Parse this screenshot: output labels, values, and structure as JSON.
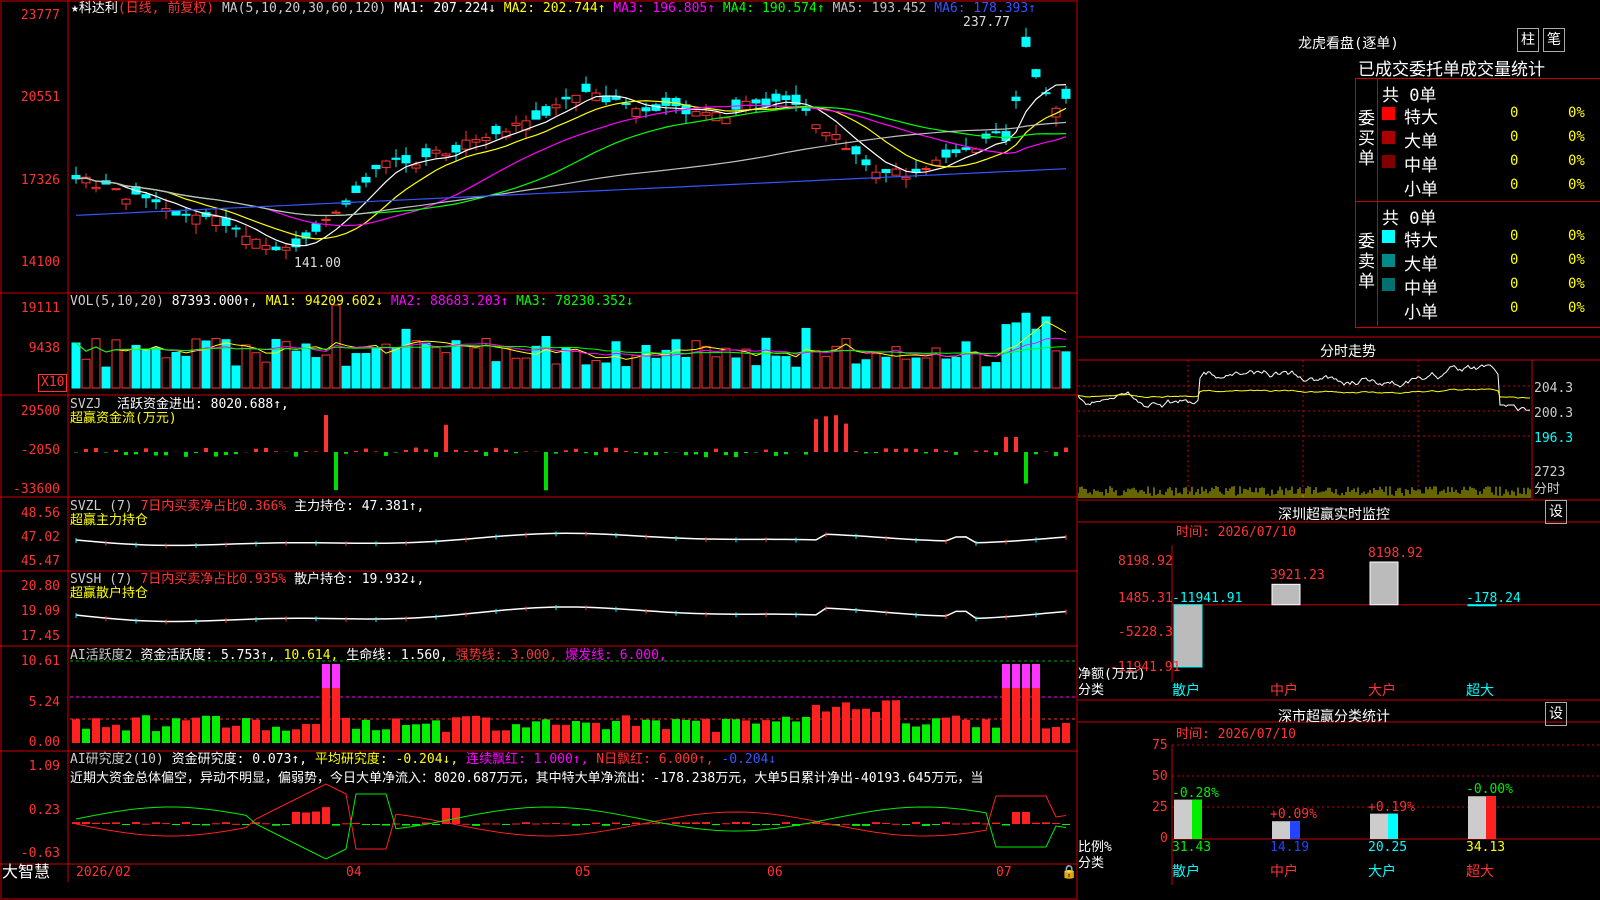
{
  "stock": {
    "name": "科达利",
    "mode": "(日线, 前复权)",
    "ma_params": "MA(5,10,20,30,60,120)",
    "ma": [
      {
        "label": "MA1:",
        "value": "207.224↓",
        "color": "#ffffff"
      },
      {
        "label": "MA2:",
        "value": "202.744↑",
        "color": "#ffff00"
      },
      {
        "label": "MA3:",
        "value": "196.805↑",
        "color": "#ff00ff"
      },
      {
        "label": "MA4:",
        "value": "190.574↑",
        "color": "#00ff00"
      },
      {
        "label": "MA5:",
        "value": "193.452",
        "color": "#c0c0c0"
      },
      {
        "label": "MA6:",
        "value": "178.393↑",
        "color": "#3355ff"
      }
    ],
    "high_label": "237.77",
    "low_label": "141.00",
    "price_axis": [
      "23777",
      "20551",
      "17326",
      "14100"
    ]
  },
  "vol": {
    "params": "VOL(5,10,20)",
    "value": "87393.000↑",
    "ma": [
      {
        "label": "MA1:",
        "value": "94209.602↓",
        "color": "#ffff00"
      },
      {
        "label": "MA2:",
        "value": "88683.203↑",
        "color": "#ff00ff"
      },
      {
        "label": "MA3:",
        "value": "78230.352↓",
        "color": "#00ff00"
      }
    ],
    "axis": [
      "19111",
      "9438"
    ],
    "unit": "X10"
  },
  "svzj": {
    "title": "SVZJ",
    "text": "活跃资金进出: 8020.688↑,",
    "sub": "超赢资金流(万元)",
    "axis": [
      "29500",
      "-2050",
      "-33600"
    ]
  },
  "svzl": {
    "title": "SVZL (7)",
    "red": "7日内买卖净占比0.366%",
    "white": "主力持仓: 47.381↑,",
    "sub": "超赢主力持仓",
    "axis": [
      "48.56",
      "47.02",
      "45.47"
    ]
  },
  "svsh": {
    "title": "SVSH (7)",
    "red": "7日内买卖净占比0.935%",
    "white": "散户持仓: 19.932↓,",
    "sub": "超赢散户持仓",
    "axis": [
      "20.80",
      "19.09",
      "17.45"
    ]
  },
  "ai1": {
    "title": "AI活跃度2",
    "a": "资金活跃度: 5.753↑,",
    "b": "10.614,",
    "c": "生命线: 1.560,",
    "d": "强势线: 3.000,",
    "e": "爆发线: 6.000,",
    "axis": [
      "10.61",
      "5.24",
      "0.00"
    ]
  },
  "ai2": {
    "title": "AI研究度2(10)",
    "a": "资金研究度: 0.073↑,",
    "b": "平均研究度: -0.204↓,",
    "c": "连续飘红: 1.000↑,",
    "d": "N日飘红: 6.000↑,",
    "e": "-0.204↓",
    "comment": "近期大资金总体偏空，异动不明显，偏弱势，今日大单净流入：8020.687万元，其中特大单净流出：-178.238万元，大单5日累计净出-40193.645万元，当",
    "axis": [
      "1.09",
      "0.23",
      "-0.63"
    ]
  },
  "xaxis": {
    "labels": [
      "2026/02",
      "04",
      "05",
      "06",
      "07"
    ]
  },
  "bottom": {
    "app": "大智慧"
  },
  "panel": {
    "title": "龙虎看盘(逐单)",
    "btn1": "柱",
    "btn2": "笔",
    "header": "已成交委托单成交量统计",
    "buy": {
      "side": "委买单",
      "total": "共 0单",
      "rows": [
        {
          "name": "特大",
          "v1": "0",
          "v2": "0%",
          "color": "#ff0000"
        },
        {
          "name": "大单",
          "v1": "0",
          "v2": "0%",
          "color": "#aa0000"
        },
        {
          "name": "中单",
          "v1": "0",
          "v2": "0%",
          "color": "#800000"
        },
        {
          "name": "小单",
          "v1": "0",
          "v2": "0%",
          "color": "#000000"
        }
      ]
    },
    "sell": {
      "side": "委卖单",
      "total": "共 0单",
      "rows": [
        {
          "name": "特大",
          "v1": "0",
          "v2": "0%",
          "color": "#00ffff"
        },
        {
          "name": "大单",
          "v1": "0",
          "v2": "0%",
          "color": "#008b8b"
        },
        {
          "name": "中单",
          "v1": "0",
          "v2": "0%",
          "color": "#007070"
        },
        {
          "name": "小单",
          "v1": "0",
          "v2": "0%",
          "color": "#000000"
        }
      ]
    }
  },
  "intraday": {
    "title": "分时走势",
    "axis": [
      "204.3",
      "200.3",
      "196.3"
    ],
    "vol_axis": [
      "2723",
      "分时"
    ]
  },
  "monitor": {
    "title": "深圳超赢实时监控",
    "set": "设",
    "time": "时间: 2026/07/10",
    "axis": [
      "8198.92",
      "1485.31",
      "-5228.3",
      "-11941.91"
    ],
    "unit": "净额(万元)",
    "cat": "分类"
  },
  "classify": {
    "title": "深市超赢分类统计",
    "set": "设",
    "time": "时间: 2026/07/10",
    "axis": [
      "75",
      "50",
      "25",
      "0"
    ],
    "unit": "比例%",
    "cat": "分类"
  },
  "chart_data": [
    {
      "type": "bar",
      "title": "深圳超赢实时监控",
      "ylabel": "净额(万元)",
      "xlabel": "分类",
      "categories": [
        "散户",
        "中户",
        "大户",
        "超大"
      ],
      "values": [
        -11941.91,
        3921.23,
        8198.92,
        -178.24
      ],
      "ylim": [
        -11941.91,
        8198.92
      ]
    },
    {
      "type": "bar",
      "title": "深市超赢分类统计",
      "ylabel": "比例%",
      "xlabel": "分类",
      "categories": [
        "散户",
        "中户",
        "大户",
        "超大"
      ],
      "values": [
        31.43,
        14.19,
        20.25,
        34.13
      ],
      "deltas": [
        "-0.28%",
        "+0.09%",
        "+0.19%",
        "-0.00%"
      ],
      "ylim": [
        0,
        75
      ]
    }
  ]
}
